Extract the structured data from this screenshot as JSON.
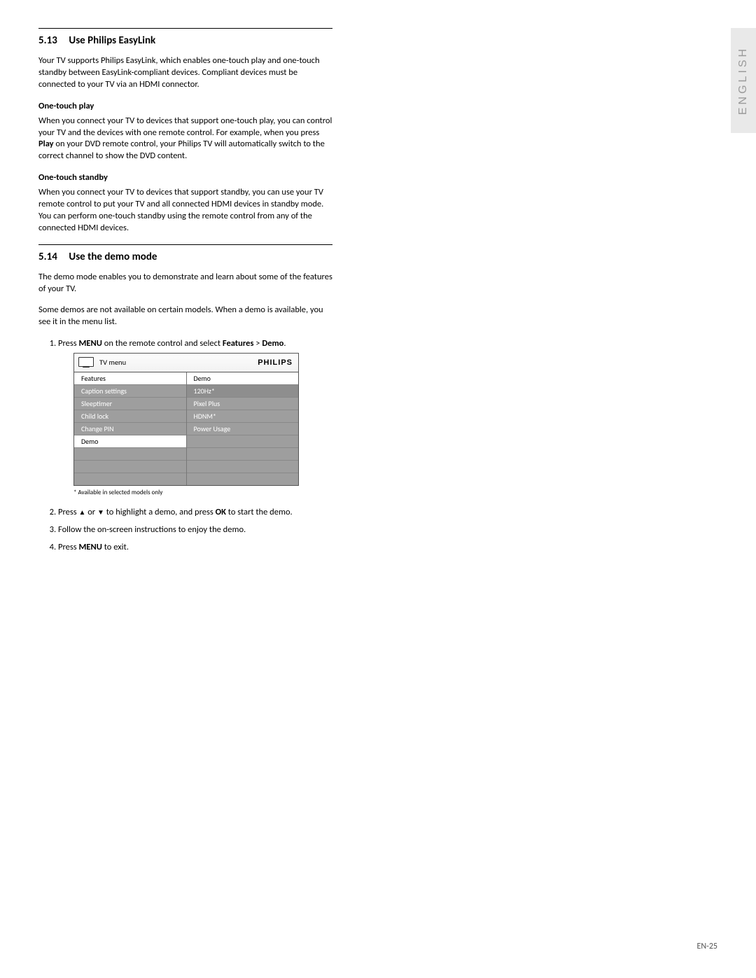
{
  "sideTab": {
    "label": "ENGLISH"
  },
  "pageNumber": "EN-25",
  "section513": {
    "number": "5.13",
    "title": "Use Philips EasyLink",
    "intro": "Your TV supports Philips EasyLink, which enables one-touch play and one-touch standby between EasyLink-compliant devices.  Compliant devices must be connected to your TV via an HDMI connector.",
    "sub1": {
      "heading": "One-touch play",
      "text_a": "When you connect your TV to devices that support one-touch play, you can control your TV and the devices with one remote control.  For example, when you press ",
      "text_bold": "Play",
      "text_b": " on your DVD remote control, your Philips TV will automatically switch to the correct channel to show the DVD content."
    },
    "sub2": {
      "heading": "One-touch standby",
      "text": "When you connect your TV to devices that support standby, you can use your TV remote control to put your TV and all connected HDMI devices in standby mode.  You can perform one-touch standby using the remote control from any of the connected HDMI devices."
    }
  },
  "section514": {
    "number": "5.14",
    "title": "Use the demo mode",
    "p1": "The demo mode enables you to demonstrate and learn about some of the features of your TV.",
    "p2": "Some demos are not available on certain models.  When a demo is available, you see it in the menu list.",
    "step1": {
      "a": "Press ",
      "b1": "MENU",
      "c": " on the remote control and select ",
      "b2": "Features",
      "d": " > ",
      "b3": "Demo",
      "e": "."
    },
    "step2": {
      "a": "Press ",
      "b": " or ",
      "c": " to highlight a demo, and press ",
      "bold": "OK",
      "d": " to start the demo."
    },
    "step3": "Follow the on-screen instructions to enjoy the demo.",
    "step4": {
      "a": "Press ",
      "bold": "MENU",
      "b": " to exit."
    },
    "menu": {
      "title": "TV menu",
      "brand": "PHILIPS",
      "leftHeader": "Features",
      "rightHeader": "Demo",
      "left": [
        "Caption settings",
        "Sleeptimer",
        "Child lock",
        "Change PIN",
        "Demo"
      ],
      "right": [
        "120Hz*",
        "Pixel Plus",
        "HDNM*",
        "Power Usage"
      ],
      "note": "* Available in selected models only"
    }
  }
}
